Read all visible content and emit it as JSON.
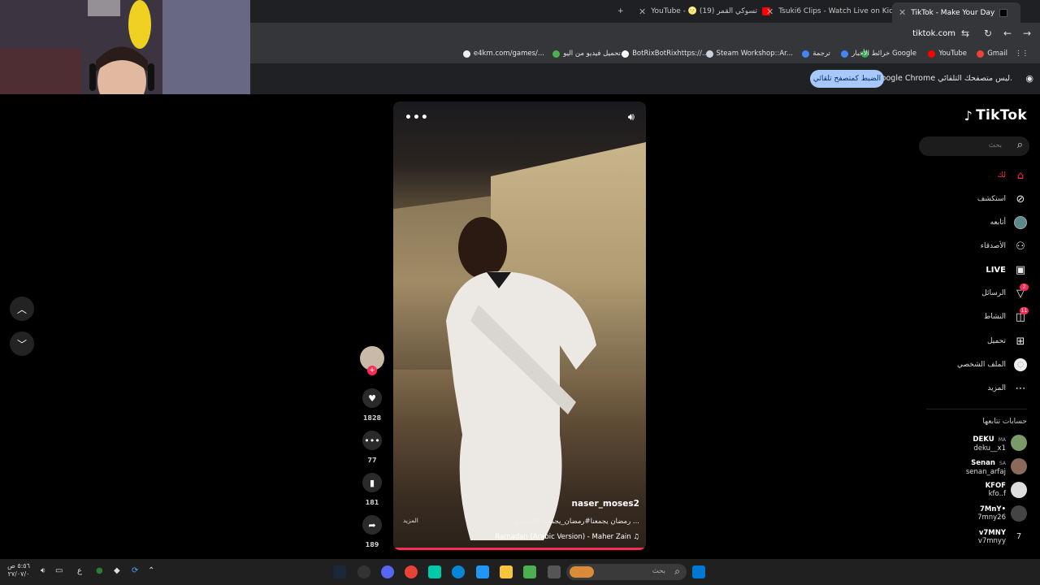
{
  "browser": {
    "tabs": [
      {
        "label": "TikTok - Make Your Day",
        "active": true
      },
      {
        "label": "Tsuki6 Clips - Watch Live on Kic",
        "active": false
      },
      {
        "label": "YouTube - 🌝 تسوكي القمر (19)",
        "active": false
      }
    ],
    "new_tab_label": "+",
    "url": "tiktok.com",
    "bookmarks": [
      {
        "label": "Gmail",
        "color": "#ea4335"
      },
      {
        "label": "YouTube",
        "color": "#ff0000"
      },
      {
        "label": "خرائط Google",
        "color": "#34a853"
      },
      {
        "label": "الأخبار",
        "color": "#4285f4"
      },
      {
        "label": "ترجمة",
        "color": "#4285f4"
      },
      {
        "label": "Steam Workshop::Ar...",
        "color": "#1b2838"
      },
      {
        "label": "BotRixBotRixhttps://...",
        "color": "#ffffff"
      },
      {
        "label": "تحميل فيديو من اليو...",
        "color": "#4caf50"
      },
      {
        "label": "e4km.com/games/...",
        "color": "#ffffff"
      }
    ],
    "infobar": {
      "message": "Google Chrome ليس متصفحك التلقائي.",
      "button": "الضبط كمتصفح تلقائي"
    }
  },
  "sidebar": {
    "logo": "TikTok",
    "search_placeholder": "بحث",
    "nav": [
      {
        "label": "لك",
        "icon": "home-icon",
        "active": true
      },
      {
        "label": "استكشف",
        "icon": "compass-icon"
      },
      {
        "label": "أتابعه",
        "icon": "following-avatar-icon"
      },
      {
        "label": "الأصدقاء",
        "icon": "friends-icon"
      },
      {
        "label": "LIVE",
        "icon": "live-icon"
      },
      {
        "label": "الرسائل",
        "icon": "messages-icon",
        "badge": "2"
      },
      {
        "label": "النشاط",
        "icon": "activity-icon",
        "badge": "11"
      },
      {
        "label": "تحميل",
        "icon": "upload-icon"
      },
      {
        "label": "الملف الشخصي",
        "icon": "profile-icon"
      },
      {
        "label": "المزيد",
        "icon": "more-icon"
      }
    ],
    "following_title": "حسابات تتابعها",
    "accounts": [
      {
        "name": "DEKU",
        "tag": "MA",
        "handle": "deku__x1"
      },
      {
        "name": "Senan",
        "tag": "SA",
        "handle": "senan_arfaj"
      },
      {
        "name": "KFOF",
        "tag": "",
        "handle": "kfo..f"
      },
      {
        "name": "7MnY•",
        "tag": "",
        "handle": "7mny26"
      },
      {
        "name": "v7MNY",
        "tag": "",
        "handle": "v7mnyy"
      }
    ]
  },
  "video": {
    "username": "naser_moses2",
    "caption": "رمضان يجمعنا#رمضان_يجمعنا #اكسبلور ...",
    "more_label": "المزيد",
    "music": "Ramadan (Arabic Version) - Maher Zain ♫",
    "progress": 0.99
  },
  "actions": {
    "likes": "1828",
    "comments": "77",
    "saves": "181",
    "shares": "189"
  },
  "taskbar": {
    "search_placeholder": "بحث",
    "clock_time": "٥:٥٦ ص",
    "clock_date": "٢٧/٠٧/٠",
    "lang": "ع"
  },
  "colors": {
    "accent": "#fe2c55",
    "infobar_button": "#a8c7fa"
  }
}
